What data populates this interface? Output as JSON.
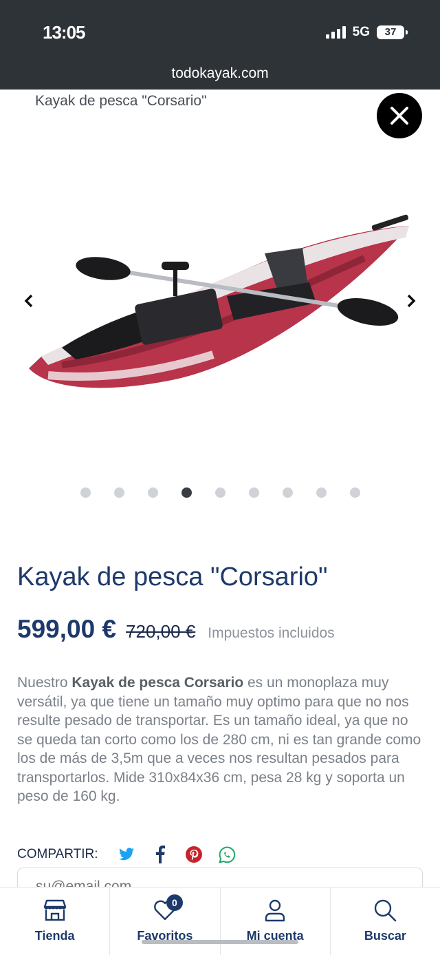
{
  "status_bar": {
    "time": "13:05",
    "network": "5G",
    "battery": "37"
  },
  "browser": {
    "url": "todokayak.com"
  },
  "breadcrumb": {
    "current": "Kayak de pesca \"Corsario\""
  },
  "gallery": {
    "slide_count": 9,
    "active_index": 3
  },
  "product": {
    "title": "Kayak de pesca \"Corsario\"",
    "price": "599,00 €",
    "old_price": "720,00 €",
    "tax_note": "Impuestos incluidos",
    "desc_prefix": "Nuestro ",
    "desc_bold": "Kayak de pesca Corsario",
    "desc_rest": " es un monoplaza muy versátil, ya que tiene un tamaño muy optimo para que no nos resulte pesado de transportar. Es un tamaño ideal, ya que no se queda tan corto como los de 280 cm, ni es tan grande como los de más de 3,5m que a veces nos resultan pesados para transportarlos. Mide 310x84x36 cm, pesa 28 kg y soporta un peso de 160 kg."
  },
  "share": {
    "label": "COMPARTIR:",
    "icons": [
      "twitter-icon",
      "facebook-icon",
      "pinterest-icon",
      "whatsapp-icon"
    ],
    "colors": {
      "twitter": "#1da1f2",
      "facebook": "#1e3a6b",
      "pinterest": "#c8232c",
      "whatsapp": "#25a86b"
    }
  },
  "newsletter": {
    "placeholder": "su@email.com"
  },
  "bottom_nav": {
    "tienda": "Tienda",
    "favoritos": "Favoritos",
    "favoritos_count": "0",
    "mi_cuenta": "Mi cuenta",
    "buscar": "Buscar"
  },
  "colors": {
    "brand": "#1e3a6b",
    "topbar": "#2e3338"
  }
}
